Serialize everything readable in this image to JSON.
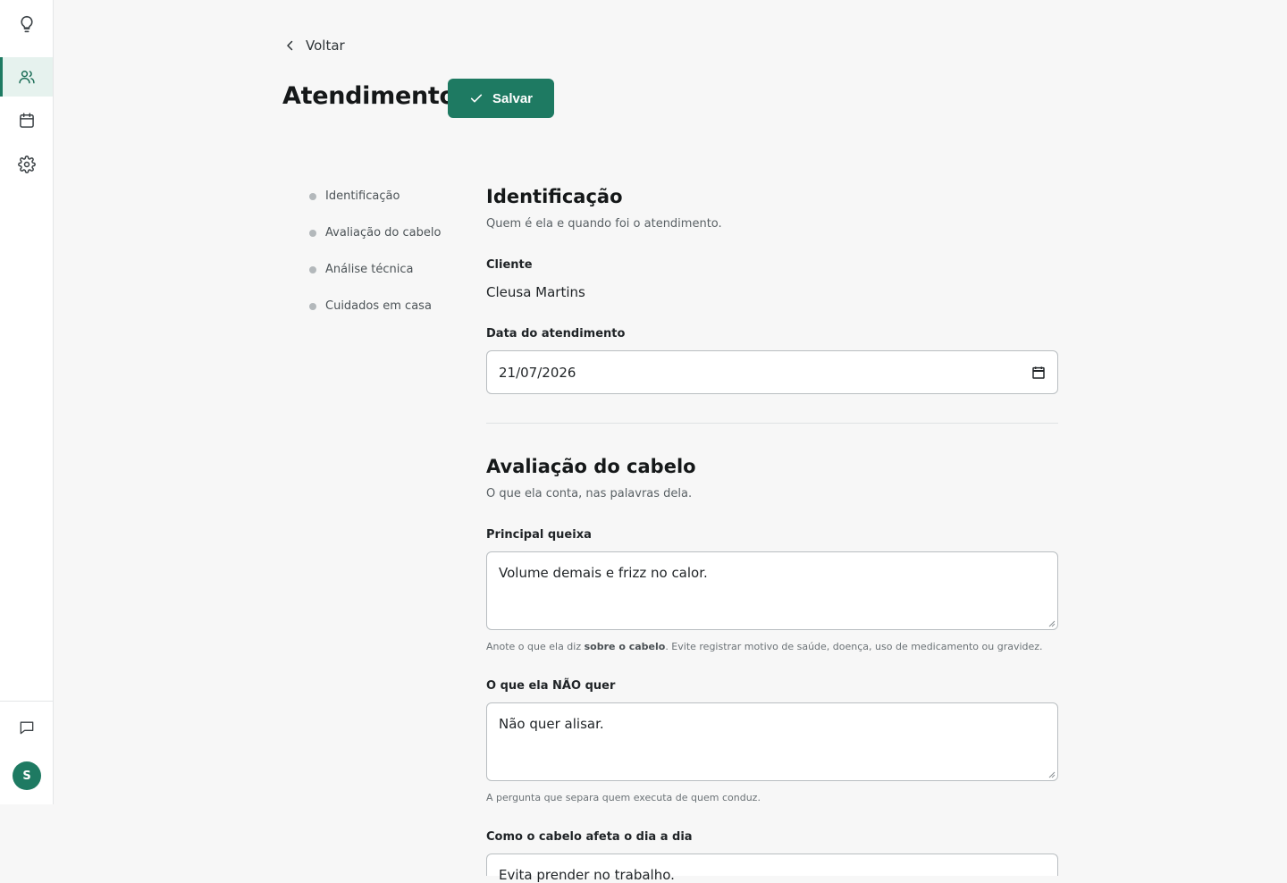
{
  "sidebar": {
    "logo_icon": "lightbulb-icon",
    "items": [
      {
        "icon": "users-icon",
        "active": true
      },
      {
        "icon": "calendar-icon",
        "active": false
      },
      {
        "icon": "gear-icon",
        "active": false
      }
    ],
    "bottom": {
      "chat_icon": "chat-icon",
      "avatar_initial": "S"
    }
  },
  "header": {
    "back_label": "Voltar",
    "title": "Atendimento",
    "save_label": "Salvar"
  },
  "toc": [
    "Identificação",
    "Avaliação do cabelo",
    "Análise técnica",
    "Cuidados em casa"
  ],
  "identificacao": {
    "title": "Identificação",
    "subtitle": "Quem é ela e quando foi o atendimento.",
    "cliente_label": "Cliente",
    "cliente_value": "Cleusa Martins",
    "data_label": "Data do atendimento",
    "data_value": "21/07/2026"
  },
  "avaliacao": {
    "title": "Avaliação do cabelo",
    "subtitle": "O que ela conta, nas palavras dela.",
    "queixa_label": "Principal queixa",
    "queixa_value": "Volume demais e frizz no calor.",
    "queixa_hint_pre": "Anote o que ela diz ",
    "queixa_hint_bold": "sobre o cabelo",
    "queixa_hint_post": ". Evite registrar motivo de saúde, doença, uso de medicamento ou gravidez.",
    "nao_quer_label": "O que ela NÃO quer",
    "nao_quer_value": "Não quer alisar.",
    "nao_quer_hint": "A pergunta que separa quem executa de quem conduz.",
    "dia_a_dia_label": "Como o cabelo afeta o dia a dia",
    "dia_a_dia_value": "Evita prender no trabalho."
  },
  "colors": {
    "accent": "#1e7a62",
    "accent_light": "#e6f2ee",
    "background": "#f7f7f7"
  }
}
